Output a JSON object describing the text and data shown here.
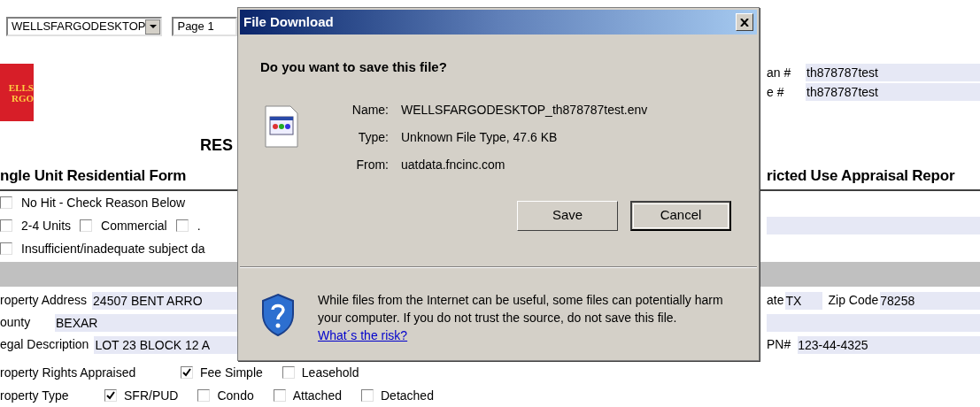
{
  "toolbar": {
    "document_select": "WELLSFARGODESKTOP",
    "page_field": "Page 1"
  },
  "logo": {
    "lines": [
      "ELLS",
      "RGO"
    ]
  },
  "loan_fields": [
    {
      "label": "an #",
      "value": "th878787test"
    },
    {
      "label": "e #",
      "value": "th878787test"
    }
  ],
  "form_title": "RES",
  "section_header": {
    "left": "ngle Unit Residential Form",
    "right": "ricted Use Appraisal Repor"
  },
  "reason_rows": [
    [
      {
        "label": "No Hit - Check Reason Below",
        "checked": false
      }
    ],
    [
      {
        "label": "2-4 Units",
        "checked": false
      },
      {
        "label": "Commercial",
        "checked": false
      },
      {
        "label": ".",
        "checked": false
      }
    ],
    [
      {
        "label": "Insufficient/inadequate subject da",
        "checked": false
      }
    ]
  ],
  "property": {
    "address_label": "roperty Address",
    "address": "24507 BENT ARRO",
    "state_label": "ate",
    "state": "TX",
    "zip_label": "Zip Code",
    "zip": "78258",
    "county_label": "ounty",
    "county": "BEXAR",
    "legal_label": "egal Description",
    "legal": "LOT 23 BLOCK 12 A",
    "apn_label": "PN#",
    "apn": "123-44-4325"
  },
  "rights": {
    "label": "roperty Rights Appraised",
    "options": [
      {
        "label": "Fee Simple",
        "checked": true
      },
      {
        "label": "Leasehold",
        "checked": false
      }
    ]
  },
  "type": {
    "label": "roperty Type",
    "options": [
      {
        "label": "SFR/PUD",
        "checked": true
      },
      {
        "label": "Condo",
        "checked": false
      },
      {
        "label": "Attached",
        "checked": false
      },
      {
        "label": "Detached",
        "checked": false
      }
    ]
  },
  "dialog": {
    "title": "File Download",
    "question": "Do you want to save this file?",
    "details": [
      {
        "label": "Name:",
        "value": "WELLSFARGODESKTOP_th878787test.env"
      },
      {
        "label": "Type:",
        "value": "Unknown File Type, 47.6 KB"
      },
      {
        "label": "From:",
        "value": "uatdata.fncinc.com"
      }
    ],
    "buttons": [
      {
        "label": "Save",
        "default": false
      },
      {
        "label": "Cancel",
        "default": true
      }
    ],
    "warning": "While files from the Internet can be useful, some files can potentially harm your computer. If you do not trust the source, do not save this file.",
    "link": "What´s the risk?"
  }
}
